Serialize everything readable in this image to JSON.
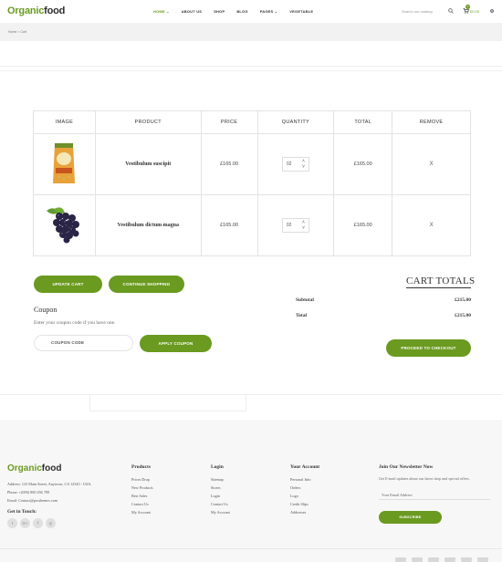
{
  "header": {
    "logo_part1": "Organic",
    "logo_part2": "food",
    "nav": [
      {
        "label": "HOME",
        "active": true
      },
      {
        "label": "ABOUT US"
      },
      {
        "label": "SHOP"
      },
      {
        "label": "BLOG"
      },
      {
        "label": "PAGES"
      },
      {
        "label": "VEGETABLE"
      }
    ],
    "search_placeholder": "Search our catalog",
    "cart_count": "0",
    "cart_total": "£0.00",
    "icons": [
      "search-icon",
      "cart-icon",
      "gear-icon",
      "chevron-down-icon"
    ]
  },
  "breadcrumb": "Home  >  Cart",
  "table": {
    "headers": [
      "IMAGE",
      "PRODUCT",
      "PRICE",
      "QUANTITY",
      "TOTAL",
      "REMOVE"
    ],
    "rows": [
      {
        "product": "Vestibulum suscipit",
        "price": "£165.00",
        "qty": "02",
        "total": "£165.00",
        "remove": "X",
        "image": "chana-dal-pack"
      },
      {
        "product": "Vestibulum dictum magna",
        "price": "£165.00",
        "qty": "02",
        "total": "£165.00",
        "remove": "X",
        "image": "black-grapes"
      }
    ]
  },
  "buttons": {
    "update": "UPDATE CART",
    "continue": "CONTINUE SHOPPING",
    "apply": "APPLY COUPON",
    "checkout": "PROCEED TO CHECKOUT",
    "subscribe": "SUBSCRIBE"
  },
  "coupon": {
    "title": "Coupon",
    "desc": "Enter your coupon code if you have one.",
    "placeholder": "COUPON CODE"
  },
  "totals": {
    "title": "CART TOTALS",
    "subtotal_label": "Subtotal",
    "subtotal_value": "£215.00",
    "total_label": "Total",
    "total_value": "£215.00"
  },
  "footer": {
    "logo_part1": "Organic",
    "logo_part2": "food",
    "address": "Address: 123 Main Street, Anytown, CA 12345 - USA.",
    "phone": "Phone: +(000) 800 456 789",
    "email": "Email: Contact@posthemes.com",
    "get_in_touch": "Get in Touch:",
    "social": [
      "twitter-icon",
      "google-plus-icon",
      "facebook-icon",
      "instagram-icon"
    ],
    "columns": [
      {
        "title": "Products",
        "items": [
          "Prices Drop",
          "New Products",
          "Best Sales",
          "Contact Us",
          "My Account"
        ]
      },
      {
        "title": "Login",
        "items": [
          "Sitemap",
          "Stores",
          "Login",
          "Contact Us",
          "My Account"
        ]
      },
      {
        "title": "Your Account",
        "items": [
          "Personal Info",
          "Orders",
          "Logo",
          "Credit Slips",
          "Addresses"
        ]
      }
    ],
    "newsletter_title": "Join Our Newsletter Now",
    "newsletter_desc": "Get E-mail updates about our latest shop and special offers.",
    "newsletter_placeholder": "Your Email Address"
  },
  "colors": {
    "accent": "#6a9a1f",
    "border": "#e3e3e3",
    "footer_bg": "#f7f7f7"
  }
}
